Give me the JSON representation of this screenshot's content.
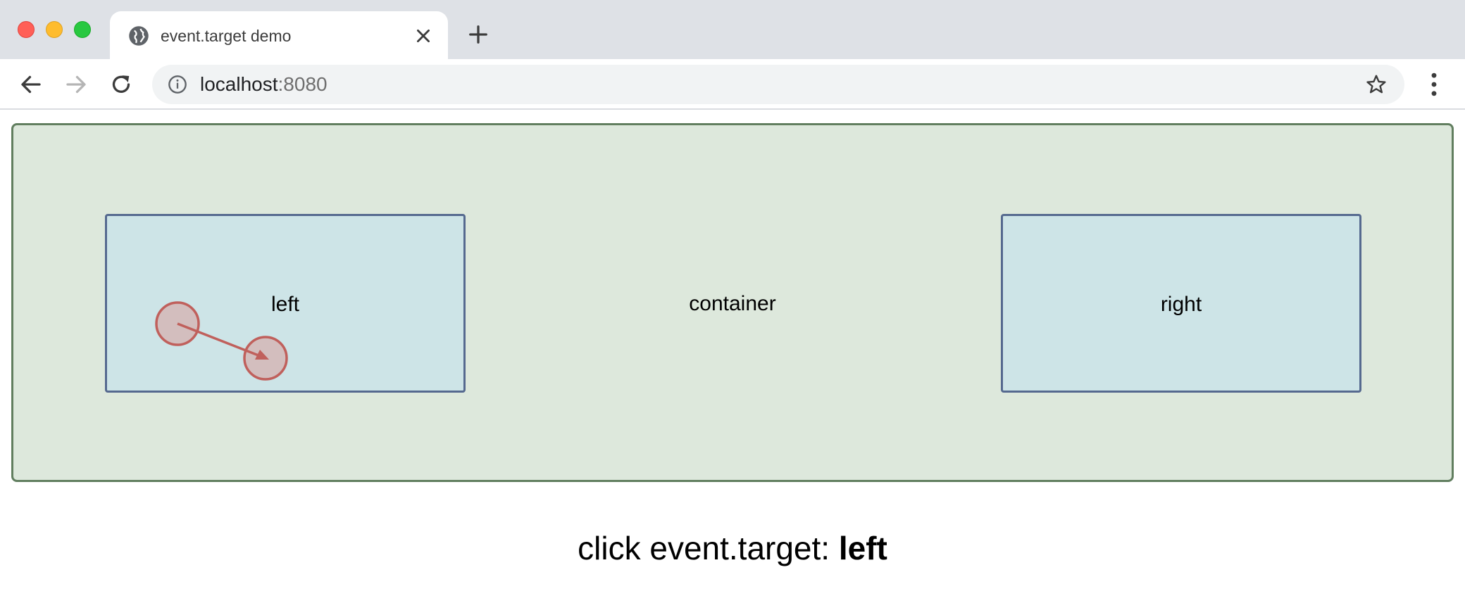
{
  "browser": {
    "tab": {
      "title": "event.target demo",
      "icon": "globe-icon"
    },
    "omnibox": {
      "url_host": "localhost",
      "url_port": ":8080",
      "icon": "info-icon"
    },
    "icons": [
      "back-arrow-icon",
      "forward-arrow-icon",
      "reload-icon",
      "star-icon",
      "menu-dots-icon",
      "close-icon",
      "plus-icon"
    ]
  },
  "page": {
    "container_label": "container",
    "left_label": "left",
    "right_label": "right",
    "result_prefix": "click event.target:",
    "result_value": "left"
  },
  "colors": {
    "container_bg": "#dde8dc",
    "container_border": "#617e5f",
    "box_bg": "#cde4e7",
    "box_border": "#55698f",
    "click_marker": "#c0605c"
  }
}
